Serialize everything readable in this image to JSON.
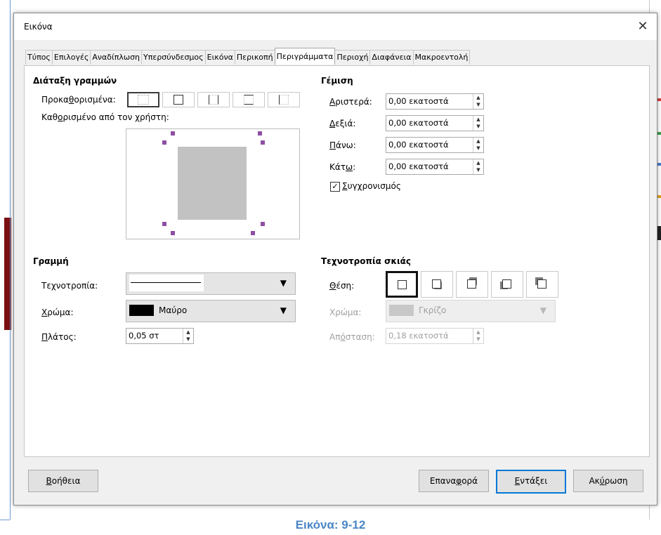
{
  "dialog": {
    "title": "Εικόνα",
    "close_glyph": "✕"
  },
  "tabs": [
    {
      "label": "Τύπος"
    },
    {
      "label": "Επιλογές"
    },
    {
      "label": "Αναδίπλωση"
    },
    {
      "label": "Υπερσύνδεσμος"
    },
    {
      "label": "Εικόνα"
    },
    {
      "label": "Περικοπή"
    },
    {
      "label": "Περιγράμματα",
      "active": true
    },
    {
      "label": "Περιοχή"
    },
    {
      "label": "Διαφάνεια"
    },
    {
      "label": "Μακροεντολή"
    }
  ],
  "line_arrangement": {
    "title": "Διάταξη γραμμών",
    "presets_label_pre": "Προκα",
    "presets_label_u": "θ",
    "presets_label_post": "ορισμένα:",
    "user_label_pre": "Καθ",
    "user_label_u": "ο",
    "user_label_post": "ρισμένο από τον χρήστη:"
  },
  "padding": {
    "title": "Γέμιση",
    "left": {
      "label_u": "Α",
      "label_rest": "ριστερά:",
      "value": "0,00 εκατοστά"
    },
    "right": {
      "label_u": "Δ",
      "label_rest": "εξιά:",
      "value": "0,00 εκατοστά"
    },
    "top": {
      "label_u": "Π",
      "label_rest": "άνω:",
      "value": "0,00 εκατοστά"
    },
    "bottom": {
      "label_pre": "Κάτ",
      "label_u": "ω",
      "label_rest": ":",
      "value": "0,00 εκατοστά"
    },
    "sync": {
      "label_u": "Σ",
      "label_rest": "υγχρονισμός",
      "checked": true
    }
  },
  "line": {
    "title": "Γραμμή",
    "style_label": "Τεχνοτροπία:",
    "color_label_u": "Χ",
    "color_label_rest": "ρώμα:",
    "color_value": "Μαύρο",
    "color_swatch": "#000000",
    "width_label_u": "Π",
    "width_label_rest": "λάτος:",
    "width_value": "0,05 στ"
  },
  "shadow": {
    "title": "Τεχνοτροπία σκιάς",
    "position_label_u": "Θ",
    "position_label_rest": "έση:",
    "color_label": "Χρώμα:",
    "color_value": "Γκρίζο",
    "color_swatch": "#c8c8c8",
    "distance_label_pre": "Απ",
    "distance_label_u": "ό",
    "distance_label_rest": "σταση:",
    "distance_value": "0,18 εκατοστά"
  },
  "buttons": {
    "help_u": "Β",
    "help_rest": "οήθεια",
    "reset_pre": "Επανα",
    "reset_u": "φ",
    "reset_rest": "ορά",
    "ok_u": "Ε",
    "ok_rest": "ντάξει",
    "cancel_pre": "Ακ",
    "cancel_u": "ύ",
    "cancel_rest": "ρωση"
  },
  "caption": "Εικόνα: 9-12",
  "colors": {
    "accent": "#0078d7",
    "handle": "#8e4fa4",
    "caption": "#4a86c5"
  }
}
